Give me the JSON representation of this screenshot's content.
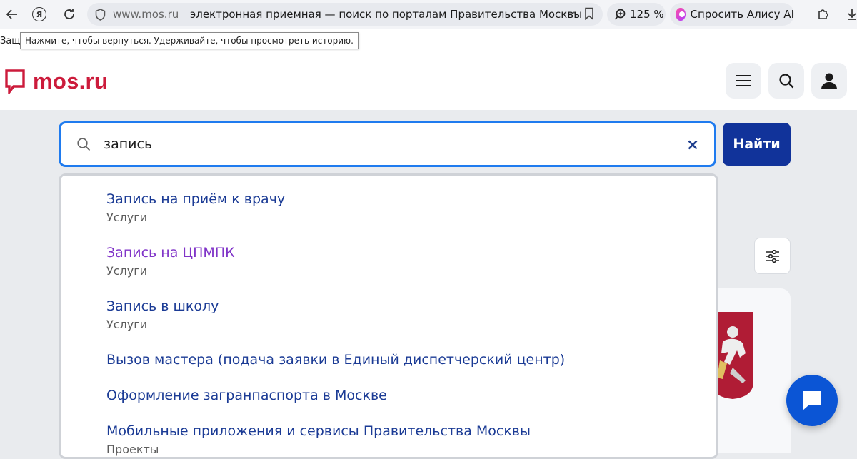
{
  "browser": {
    "domain": "www.mos.ru",
    "page_title": "электронная приемная — поиск по порталам Правительства Москвы",
    "more_label": "···",
    "zoom": "125 %",
    "alice_label": "Спросить Алису AI",
    "cut_label": "Защи",
    "tooltip": "Нажмите, чтобы вернуться. Удерживайте, чтобы просмотреть историю.",
    "yandex_letter": "Я"
  },
  "site": {
    "logo_text": "mos.ru",
    "brand_color": "#cc1b3b"
  },
  "search": {
    "value": "запись",
    "find_label": "Найти",
    "accent": "#1f7bef"
  },
  "suggestions": [
    {
      "title": "Запись на приём к врачу",
      "category": "Услуги",
      "visited": false
    },
    {
      "title": "Запись на ЦПМПК",
      "category": "Услуги",
      "visited": true
    },
    {
      "title": "Запись в школу",
      "category": "Услуги",
      "visited": false
    },
    {
      "title": "Вызов мастера (подача заявки в Единый диспетчерский центр)",
      "category": "",
      "visited": false
    },
    {
      "title": "Оформление загранпаспорта в Москве",
      "category": "",
      "visited": false
    },
    {
      "title": "Мобильные приложения и сервисы Правительства Москвы",
      "category": "Проекты",
      "visited": false
    }
  ]
}
